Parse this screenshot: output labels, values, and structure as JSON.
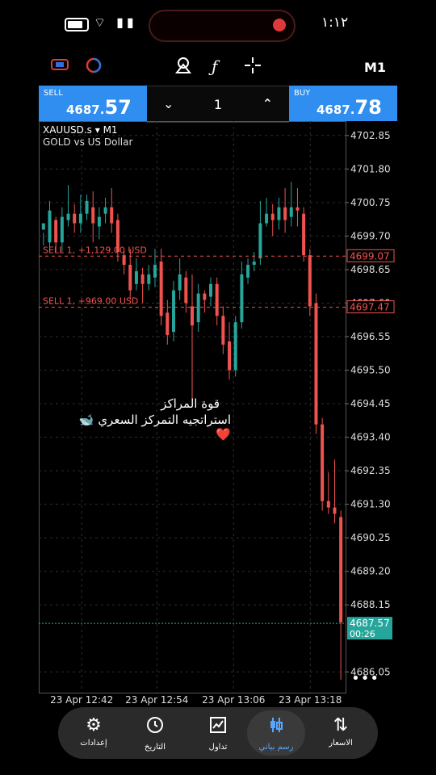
{
  "status_bar": {
    "time": "١:١٢"
  },
  "toolbar": {
    "timeframe": "M1",
    "function_icon": "ƒ"
  },
  "trade": {
    "sell_label": "SELL",
    "sell_price_small": "4687.",
    "sell_price_big": "57",
    "buy_label": "BUY",
    "buy_price_small": "4687.",
    "buy_price_big": "78",
    "volume": "1",
    "down_glyph": "⌄",
    "up_glyph": "⌃"
  },
  "chart": {
    "symbol": "XAUUSD.s ▾ M1",
    "description": "GOLD vs US Dollar",
    "more_menu": "•••",
    "overlay_line1": "قوة المراكز",
    "overlay_line2": "استراتجيه التمركز السعري 🐋❤️"
  },
  "chart_data": {
    "type": "candlestick",
    "symbol": "XAUUSD.s",
    "timeframe": "M1",
    "ylim": [
      4685.4,
      4703.3
    ],
    "price_ticks": [
      "4702.85",
      "4701.80",
      "4700.75",
      "4699.70",
      "4698.65",
      "4697.60",
      "4696.55",
      "4695.50",
      "4694.45",
      "4693.40",
      "4692.35",
      "4691.30",
      "4690.25",
      "4689.20",
      "4688.15",
      "4686.05"
    ],
    "time_labels": [
      "23 Apr 12:42",
      "23 Apr 12:54",
      "23 Apr 13:06",
      "23 Apr 13:18"
    ],
    "current_price": "4687.57",
    "countdown": "00:26",
    "orders": [
      {
        "label": "SELL 1, +1,129.00 USD",
        "price": "4699.07"
      },
      {
        "label": "SELL 1, +969.00 USD",
        "price": "4697.47"
      }
    ],
    "colors": {
      "up": "#26a69a",
      "down": "#ef5350",
      "order": "#ef5350",
      "bid": "#26a69a"
    },
    "candles": [
      [
        4699.9,
        4700.1,
        4699.8,
        4699.4
      ],
      [
        4699.5,
        4700.5,
        4700.8,
        4699.2
      ],
      [
        4700.2,
        4699.5,
        4700.3,
        4699.2
      ],
      [
        4699.5,
        4700.3,
        4700.6,
        4699.2
      ],
      [
        4700.2,
        4700.4,
        4701.3,
        4700.0
      ],
      [
        4700.4,
        4700.1,
        4700.7,
        4699.8
      ],
      [
        4700.1,
        4700.4,
        4701.0,
        4699.8
      ],
      [
        4700.4,
        4700.8,
        4701.0,
        4700.2
      ],
      [
        4700.6,
        4700.1,
        4701.1,
        4699.5
      ],
      [
        4700.0,
        4700.3,
        4700.6,
        4699.6
      ],
      [
        4700.4,
        4700.6,
        4700.9,
        4700.1
      ],
      [
        4700.6,
        4700.1,
        4701.2,
        4699.8
      ],
      [
        4700.2,
        4699.2,
        4700.4,
        4698.9
      ],
      [
        4699.1,
        4698.8,
        4699.3,
        4698.5
      ],
      [
        4698.8,
        4698.0,
        4699.3,
        4697.7
      ],
      [
        4698.2,
        4698.6,
        4699.0,
        4698.0
      ],
      [
        4698.5,
        4698.2,
        4698.7,
        4697.6
      ],
      [
        4698.2,
        4698.5,
        4698.8,
        4698.0
      ],
      [
        4698.4,
        4698.8,
        4699.3,
        4698.1
      ],
      [
        4698.9,
        4697.2,
        4699.3,
        4696.9
      ],
      [
        4697.3,
        4696.6,
        4697.7,
        4696.3
      ],
      [
        4696.7,
        4698.0,
        4698.3,
        4696.4
      ],
      [
        4698.0,
        4698.5,
        4699.0,
        4697.7
      ],
      [
        4698.4,
        4697.6,
        4698.6,
        4697.3
      ],
      [
        4697.5,
        4696.9,
        4698.5,
        4694.6
      ],
      [
        4697.0,
        4697.9,
        4698.2,
        4696.7
      ],
      [
        4697.9,
        4697.7,
        4698.0,
        4697.3
      ],
      [
        4697.8,
        4698.2,
        4698.4,
        4697.5
      ],
      [
        4698.2,
        4697.2,
        4698.4,
        4696.9
      ],
      [
        4697.2,
        4696.3,
        4697.5,
        4696.0
      ],
      [
        4696.4,
        4695.5,
        4697.0,
        4695.2
      ],
      [
        4695.5,
        4697.0,
        4697.2,
        4695.3
      ],
      [
        4697.0,
        4698.5,
        4698.9,
        4696.8
      ],
      [
        4698.4,
        4698.8,
        4699.0,
        4698.2
      ],
      [
        4698.8,
        4698.9,
        4699.2,
        4698.6
      ],
      [
        4699.0,
        4700.1,
        4700.8,
        4698.8
      ],
      [
        4700.1,
        4700.4,
        4700.9,
        4700.0
      ],
      [
        4700.4,
        4700.2,
        4700.7,
        4699.7
      ],
      [
        4700.2,
        4700.6,
        4700.9,
        4699.9
      ],
      [
        4700.6,
        4700.2,
        4701.2,
        4699.8
      ],
      [
        4700.3,
        4700.6,
        4701.4,
        4700.0
      ],
      [
        4700.6,
        4700.5,
        4701.2,
        4700.0
      ],
      [
        4700.4,
        4699.1,
        4700.6,
        4698.9
      ],
      [
        4699.1,
        4697.5,
        4699.3,
        4697.2
      ],
      [
        4697.6,
        4693.8,
        4697.9,
        4693.5
      ],
      [
        4693.8,
        4691.4,
        4694.0,
        4691.1
      ],
      [
        4691.4,
        4691.2,
        4692.3,
        4691.0
      ],
      [
        4691.2,
        4691.0,
        4692.7,
        4690.7
      ],
      [
        4690.9,
        4687.6,
        4691.1,
        4685.8
      ]
    ]
  },
  "nav": {
    "items": [
      {
        "label": "إعدادات",
        "icon": "gear-icon"
      },
      {
        "label": "التاريخ",
        "icon": "history-icon"
      },
      {
        "label": "تداول",
        "icon": "trade-icon"
      },
      {
        "label": "رسم بياني",
        "icon": "chart-icon"
      },
      {
        "label": "الاسعار",
        "icon": "quotes-icon"
      }
    ],
    "active_index": 3
  }
}
